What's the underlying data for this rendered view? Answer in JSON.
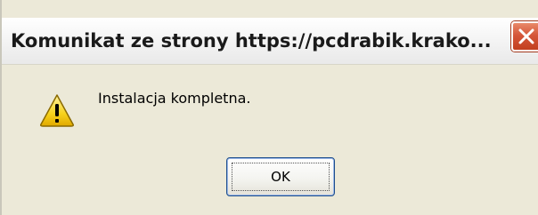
{
  "dialog": {
    "title": "Komunikat ze strony https://pcdrabik.krako...",
    "message": "Instalacja kompletna.",
    "ok_label": "OK",
    "icon": "warning-icon",
    "close_icon": "close-icon"
  },
  "colors": {
    "dialog_background": "#ece9d8",
    "close_button": "#d5563a",
    "button_border": "#1e4e8c",
    "warning_yellow": "#f7d21c"
  }
}
